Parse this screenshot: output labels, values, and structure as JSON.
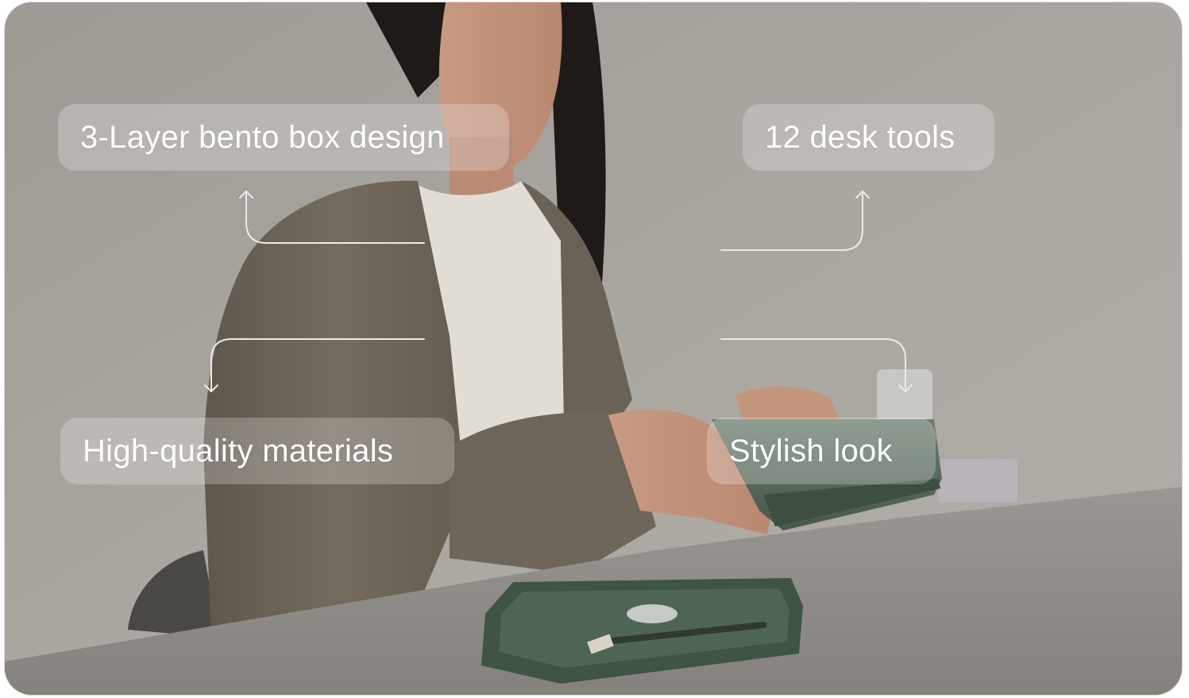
{
  "features": {
    "top_left": "3-Layer bento box design",
    "top_right": "12 desk tools",
    "bottom_left": "High-quality materials",
    "bottom_right": "Stylish look"
  },
  "colors": {
    "wall": "#a6a29c",
    "jacket": "#6f665a",
    "top": "#e2ddd4",
    "table": "#8e8a85",
    "box_green": "#4e6250",
    "label_text": "#ffffff",
    "connector": "#ecebe8"
  },
  "icons": {
    "connector_arrow": "arrow-up-icon / arrow-down-icon"
  }
}
